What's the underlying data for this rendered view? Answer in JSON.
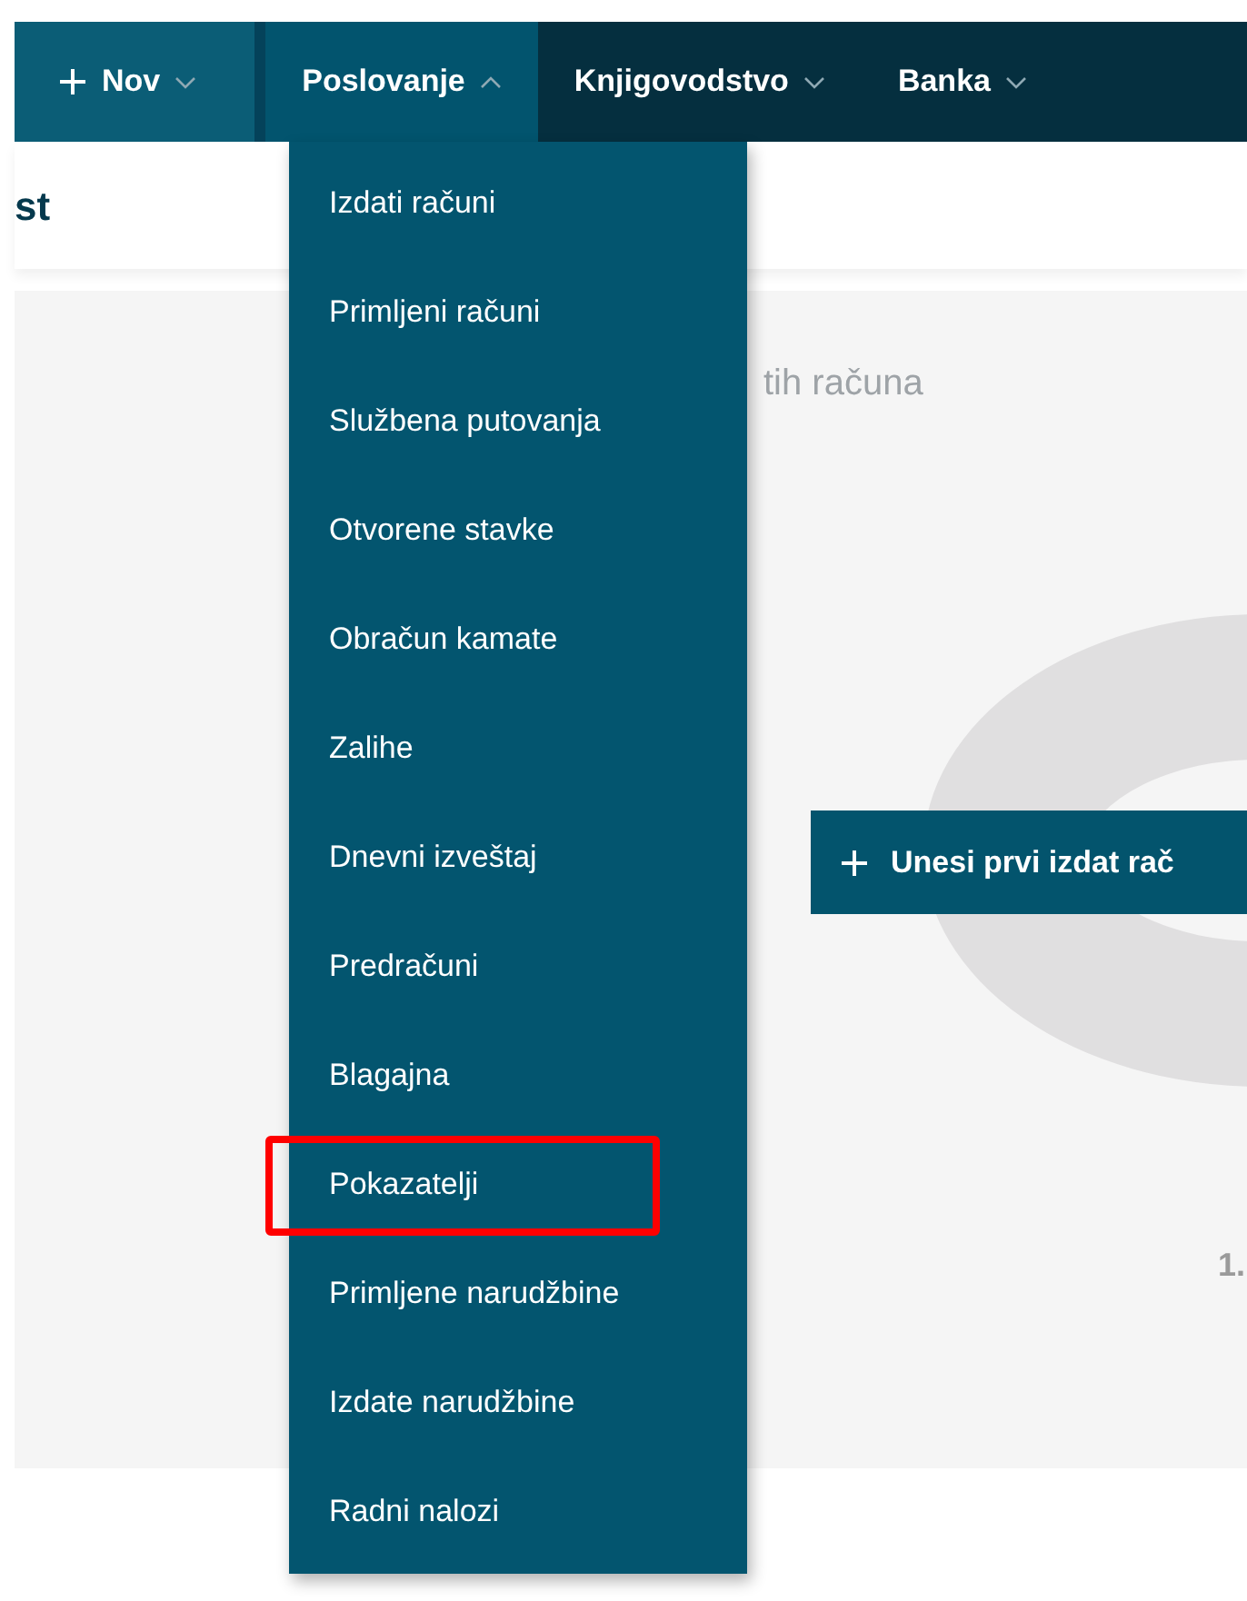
{
  "nav": {
    "items": [
      {
        "label": "Nov",
        "kind": "new",
        "expanded": false
      },
      {
        "label": "Poslovanje",
        "kind": "menu",
        "expanded": true
      },
      {
        "label": "Knjigovodstvo",
        "kind": "menu",
        "expanded": false
      },
      {
        "label": "Banka",
        "kind": "menu",
        "expanded": false
      }
    ]
  },
  "page": {
    "title": "st",
    "panel_title": "tih računa",
    "primary_button": "Unesi prvi izdat rač",
    "chart_value": "1."
  },
  "dropdown": {
    "items": [
      {
        "label": "Izdati računi",
        "highlighted": false
      },
      {
        "label": "Primljeni računi",
        "highlighted": false
      },
      {
        "label": "Službena putovanja",
        "highlighted": false
      },
      {
        "label": "Otvorene stavke",
        "highlighted": false
      },
      {
        "label": "Obračun kamate",
        "highlighted": false
      },
      {
        "label": "Zalihe",
        "highlighted": false
      },
      {
        "label": "Dnevni izveštaj",
        "highlighted": false
      },
      {
        "label": "Predračuni",
        "highlighted": false
      },
      {
        "label": "Blagajna",
        "highlighted": false
      },
      {
        "label": "Pokazatelji",
        "highlighted": true
      },
      {
        "label": "Primljene narudžbine",
        "highlighted": false
      },
      {
        "label": "Izdate narudžbine",
        "highlighted": false
      },
      {
        "label": "Radni nalozi",
        "highlighted": false
      }
    ]
  }
}
